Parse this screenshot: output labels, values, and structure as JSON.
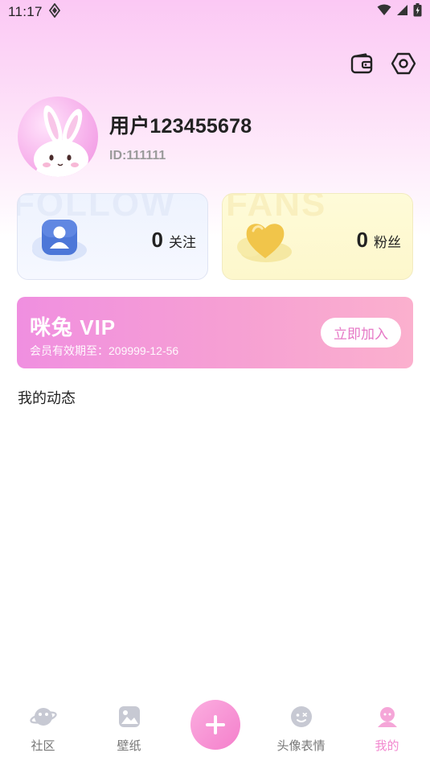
{
  "status_bar": {
    "time": "11:17",
    "icons": [
      "app-notification-icon",
      "wifi-icon",
      "signal-icon",
      "battery-icon"
    ]
  },
  "header": {
    "actions": [
      "wallet-icon",
      "settings-icon"
    ]
  },
  "profile": {
    "username": "用户123455678",
    "user_id": "ID:111111",
    "avatar_icon": "bunny-avatar"
  },
  "stats": {
    "follow": {
      "watermark": "FOLLOW",
      "count": "0",
      "label": "关注",
      "icon": "user-card-icon"
    },
    "fans": {
      "watermark": "FANS",
      "count": "0",
      "label": "粉丝",
      "icon": "heart-icon"
    }
  },
  "vip": {
    "title": "咪兔 VIP",
    "expiry": "会员有效期至：209999-12-56",
    "join_label": "立即加入"
  },
  "section": {
    "title": "我的动态"
  },
  "bottom_nav": {
    "items": [
      {
        "label": "社区",
        "icon": "planet-icon"
      },
      {
        "label": "壁纸",
        "icon": "image-icon"
      },
      {
        "label": "",
        "icon": "plus-icon"
      },
      {
        "label": "头像表情",
        "icon": "smiley-icon"
      },
      {
        "label": "我的",
        "icon": "profile-icon"
      }
    ],
    "active_index": 4
  },
  "colors": {
    "accent": "#f288cf",
    "header_gradient_top": "#fbc8f4",
    "vip_gradient_start": "#f08fe0",
    "vip_gradient_end": "#fbb0ce"
  }
}
